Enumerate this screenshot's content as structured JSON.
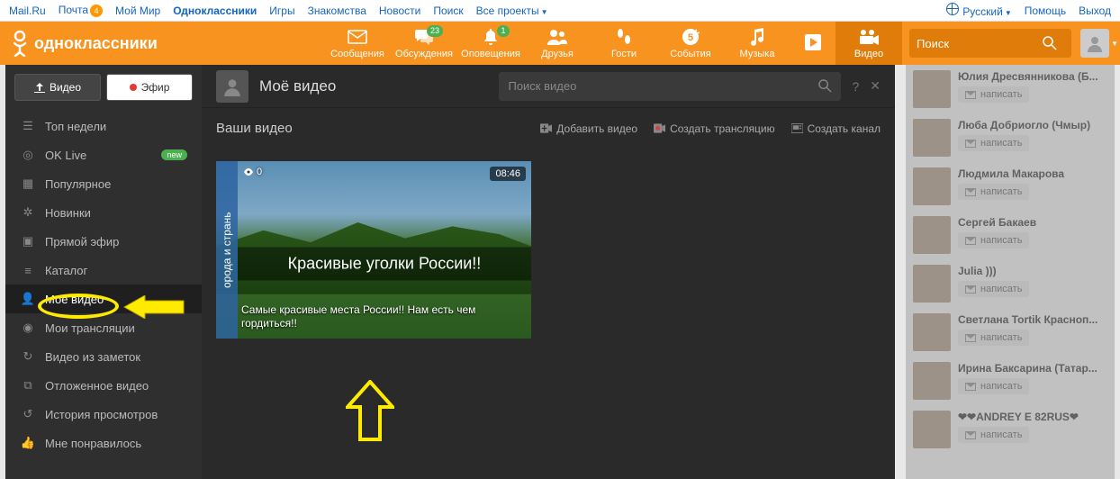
{
  "topbar": {
    "links": [
      "Mail.Ru",
      "Почта",
      "Мой Мир",
      "Одноклассники",
      "Игры",
      "Знакомства",
      "Новости",
      "Поиск",
      "Все проекты"
    ],
    "mail_badge": "4",
    "lang": "Русский",
    "help": "Помощь",
    "logout": "Выход"
  },
  "header": {
    "logo": "одноклассники",
    "nav": [
      {
        "label": "Сообщения"
      },
      {
        "label": "Обсуждения",
        "badge": "23"
      },
      {
        "label": "Оповещения",
        "badge": "1"
      },
      {
        "label": "Друзья"
      },
      {
        "label": "Гости"
      },
      {
        "label": "События"
      },
      {
        "label": "Музыка"
      },
      {
        "label": "Видео",
        "active": true
      }
    ],
    "search_placeholder": "Поиск"
  },
  "video_panel": {
    "btn_upload": "Видео",
    "btn_live": "Эфир",
    "menu": [
      {
        "label": "Топ недели"
      },
      {
        "label": "OK Live",
        "new": true
      },
      {
        "label": "Популярное"
      },
      {
        "label": "Новинки"
      },
      {
        "label": "Прямой эфир"
      },
      {
        "label": "Каталог"
      },
      {
        "label": "Моё видео",
        "active": true
      },
      {
        "label": "Мои трансляции"
      },
      {
        "label": "Видео из заметок"
      },
      {
        "label": "Отложенное видео"
      },
      {
        "label": "История просмотров"
      },
      {
        "label": "Мне понравилось"
      }
    ],
    "title": "Моё видео",
    "search_placeholder": "Поиск видео",
    "subtitle": "Ваши видео",
    "actions": {
      "add_video": "Добавить видео",
      "create_stream": "Создать трансляцию",
      "create_channel": "Создать канал"
    },
    "thumb": {
      "side_text": "орода и странь",
      "views": "0",
      "duration": "08:46",
      "banner": "Красивые уголки России!!",
      "caption": "Самые красивые места России!! Нам есть чем гордиться!!"
    }
  },
  "friends": [
    {
      "name": "Юлия Дресвянникова (Б...",
      "msg": "написать"
    },
    {
      "name": "Люба Добриогло (Чмыр)",
      "msg": "написать"
    },
    {
      "name": "Людмила Макарова",
      "msg": "написать"
    },
    {
      "name": "Сергей Бакаев",
      "msg": "написать"
    },
    {
      "name": "Julia )))",
      "msg": "написать"
    },
    {
      "name": "Светлана Tortik Красноп...",
      "msg": "написать"
    },
    {
      "name": "Ирина Баксарина (Татар...",
      "msg": "написать"
    },
    {
      "name": "❤❤ANDREY E 82RUS❤",
      "msg": "написать"
    }
  ]
}
